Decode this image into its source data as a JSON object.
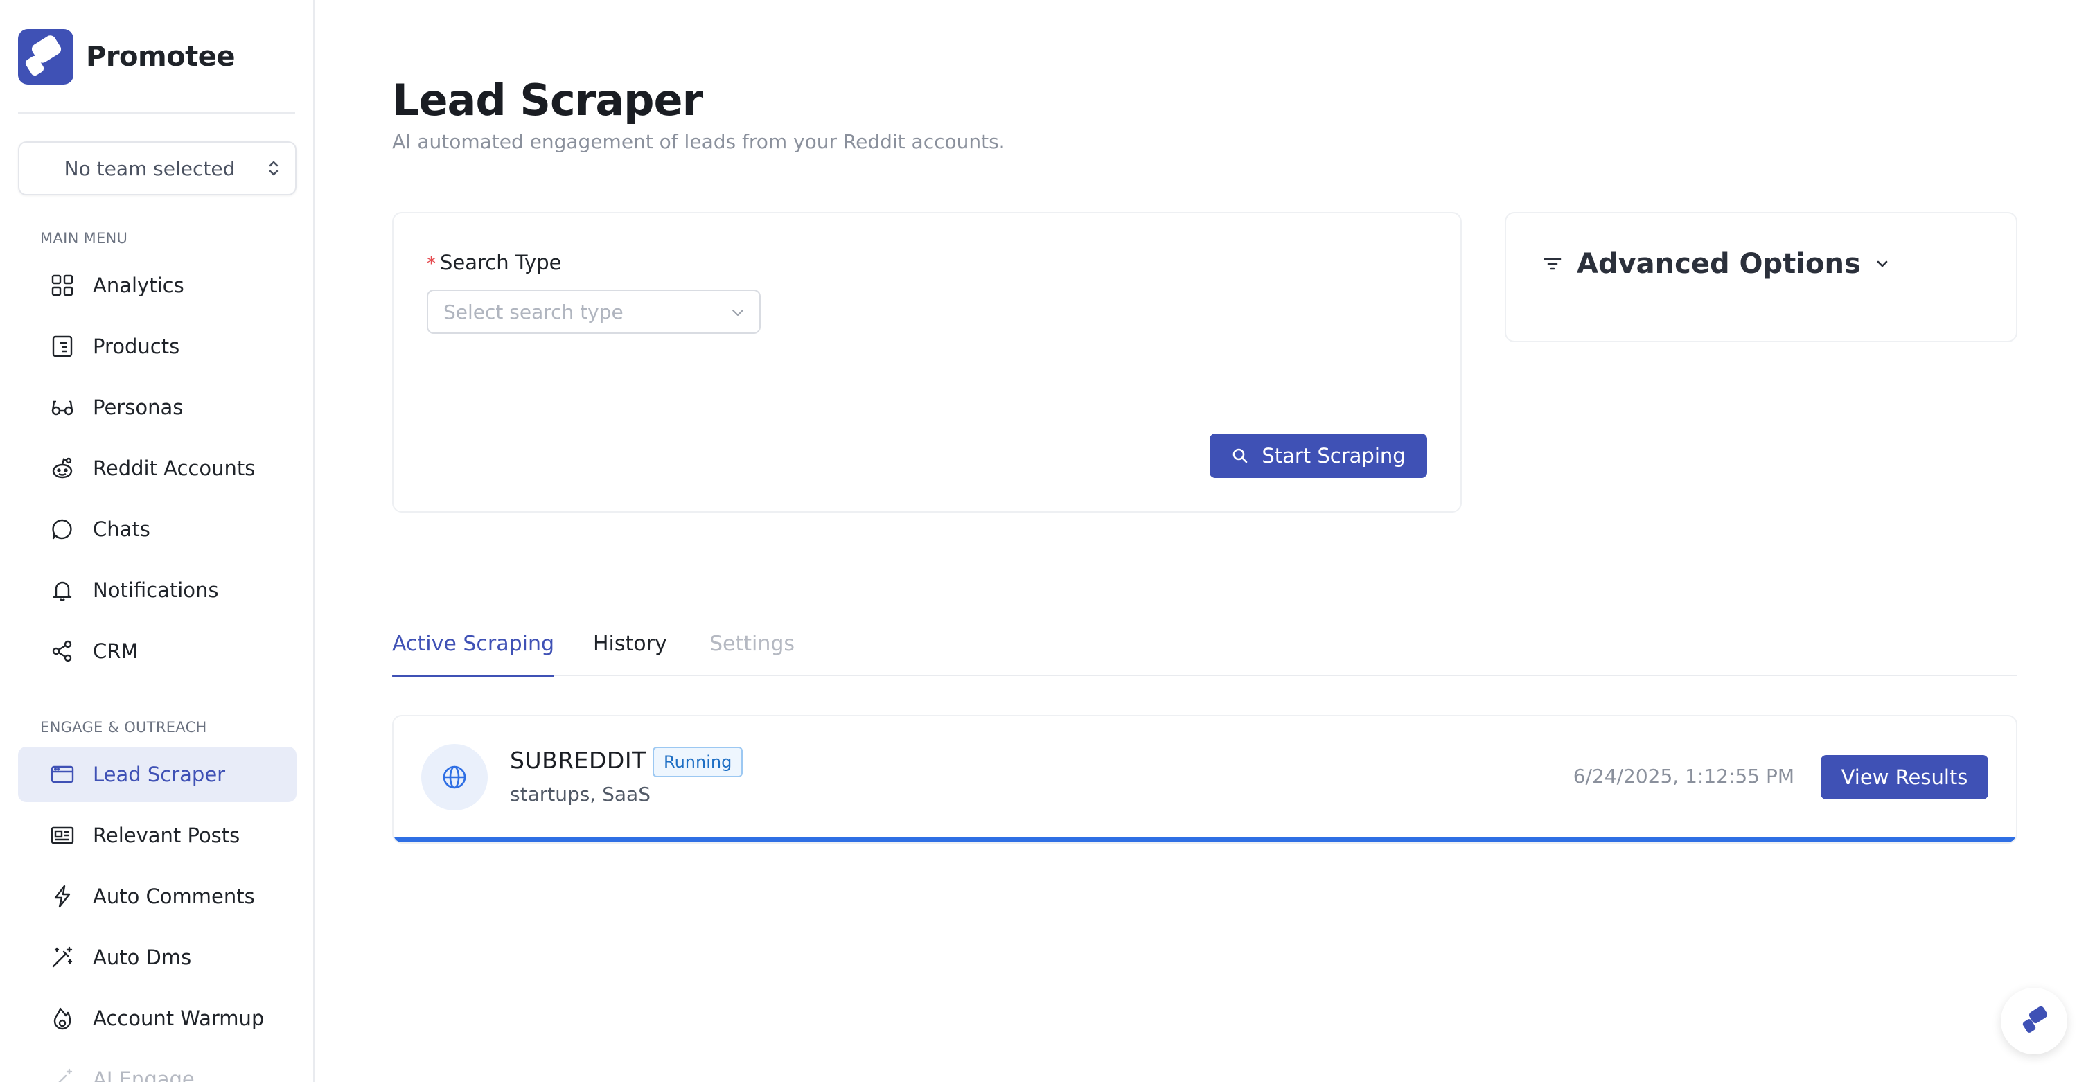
{
  "brand": {
    "name": "Promotee"
  },
  "team_select": {
    "value": "No team selected"
  },
  "sidebar": {
    "main_menu_label": "MAIN MENU",
    "main_items": [
      {
        "label": "Analytics",
        "icon": "grid-icon"
      },
      {
        "label": "Products",
        "icon": "product-icon"
      },
      {
        "label": "Personas",
        "icon": "glasses-icon"
      },
      {
        "label": "Reddit Accounts",
        "icon": "reddit-icon"
      },
      {
        "label": "Chats",
        "icon": "chat-icon"
      },
      {
        "label": "Notifications",
        "icon": "bell-icon"
      },
      {
        "label": "CRM",
        "icon": "share-icon"
      }
    ],
    "engage_label": "ENGAGE & OUTREACH",
    "engage_items": [
      {
        "label": "Lead Scraper",
        "icon": "browser-icon",
        "active": true
      },
      {
        "label": "Relevant Posts",
        "icon": "newspaper-icon"
      },
      {
        "label": "Auto Comments",
        "icon": "bolt-icon"
      },
      {
        "label": "Auto Dms",
        "icon": "magic-wand-icon"
      },
      {
        "label": "Account Warmup",
        "icon": "flame-icon"
      },
      {
        "label": "AI Engage",
        "icon": "wand-icon"
      }
    ]
  },
  "header": {
    "title": "Lead Scraper",
    "subtitle": "AI automated engagement of leads from your Reddit accounts."
  },
  "search_form": {
    "required_mark": "*",
    "search_type_label": "Search Type",
    "search_type_placeholder": "Select search type",
    "start_button": "Start Scraping"
  },
  "advanced": {
    "title": "Advanced Options"
  },
  "tabs": [
    {
      "label": "Active Scraping",
      "active": true
    },
    {
      "label": "History"
    },
    {
      "label": "Settings",
      "disabled": true
    }
  ],
  "jobs": [
    {
      "type": "SUBREDDIT",
      "status": "Running",
      "subreddits": "startups, SaaS",
      "timestamp": "6/24/2025, 1:12:55 PM",
      "action": "View Results",
      "progress": 1.0
    }
  ],
  "colors": {
    "accent": "#3f51b5",
    "progress": "#2f6fe4",
    "status_running": "#1e6fc4",
    "required": "#e5484d"
  }
}
